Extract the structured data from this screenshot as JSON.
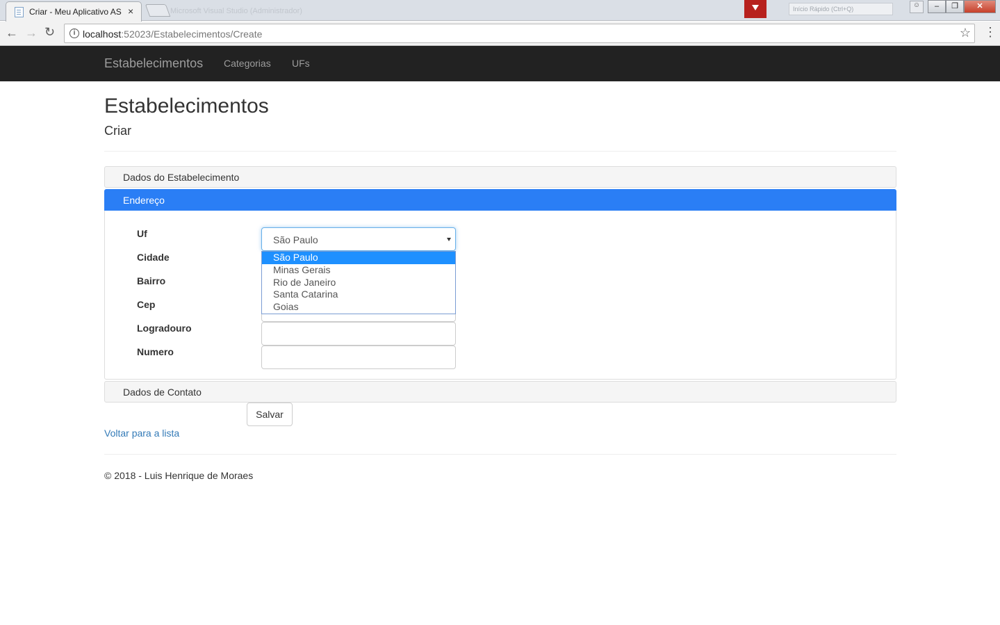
{
  "browser": {
    "tab_title": "Criar - Meu Aplicativo AS",
    "tab_close": "×",
    "bg_window_title": "Microsoft Visual Studio (Administrador)",
    "win_search_placeholder": "Início Rápido (Ctrl+Q)",
    "url_host": "localhost",
    "url_rest": ":52023/Estabelecimentos/Create"
  },
  "navbar": {
    "brand": "Estabelecimentos",
    "links": [
      "Categorias",
      "UFs"
    ]
  },
  "page": {
    "title": "Estabelecimentos",
    "subtitle": "Criar"
  },
  "panels": {
    "dados_estabelecimento": "Dados do Estabelecimento",
    "endereco": "Endereço",
    "dados_contato": "Dados de Contato"
  },
  "form": {
    "labels": {
      "uf": "Uf",
      "cidade": "Cidade",
      "bairro": "Bairro",
      "cep": "Cep",
      "logradouro": "Logradouro",
      "numero": "Numero"
    },
    "uf_selected": "São Paulo",
    "uf_options": [
      "São Paulo",
      "Minas Gerais",
      "Rio de Janeiro",
      "Santa Catarina",
      "Goias"
    ],
    "save_label": "Salvar"
  },
  "back_link": "Voltar para a lista",
  "footer": "© 2018 - Luis Henrique de Moraes",
  "colors": {
    "navbar_bg": "#222222",
    "active_panel": "#2a7ef5",
    "link": "#337ab7",
    "selected_option": "#1e90ff"
  }
}
